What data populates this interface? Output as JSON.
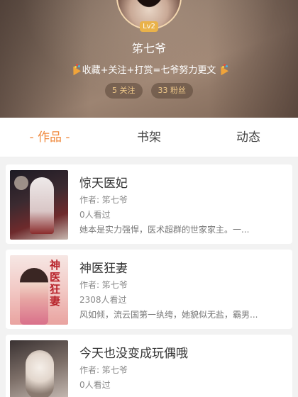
{
  "profile": {
    "level": "Lv2",
    "nickname": "笫七爷",
    "motto": "收藏+关注+打赏=七爷努力更文",
    "following": "5 关注",
    "fans": "33 粉丝",
    "decor_icon": "party-popper-icon"
  },
  "tabs": [
    {
      "label": "- 作品 -",
      "active": true
    },
    {
      "label": "书架",
      "active": false
    },
    {
      "label": "动态",
      "active": false
    }
  ],
  "books": [
    {
      "title": "惊天医妃",
      "author": "作者: 笫七爷",
      "readers": "0人看过",
      "desc": "她本是实力强悍，医术超群的世家家主。一..."
    },
    {
      "title": "神医狂妻",
      "author": "作者: 笫七爷",
      "readers": "2308人看过",
      "desc": "风如倾，流云国第一纨绔，她貌似无盐，霸男...",
      "cover_text": "神医狂妻"
    },
    {
      "title": "今天也没变成玩偶哦",
      "author": "作者: 笫七爷",
      "readers": "0人看过",
      "desc": ""
    }
  ],
  "colors": {
    "accent": "#f08a3e",
    "level_badge": "#e9b24a",
    "stat_text": "#f0c98a"
  }
}
